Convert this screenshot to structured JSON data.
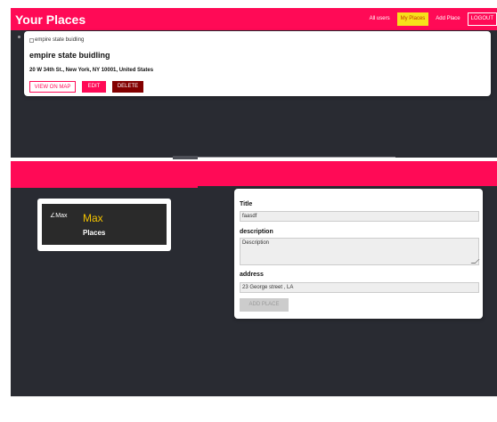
{
  "header": {
    "title": "Your Places",
    "nav": {
      "all_users": "All users",
      "my_places": "My Places",
      "add_place": "Add Place",
      "logout": "LOGOUT"
    }
  },
  "place": {
    "image_alt": "empire state buidling",
    "title": "empire state buidling",
    "address": "20 W 34th St., New York, NY 10001, United States",
    "buttons": {
      "view_on_map": "VIEW ON MAP",
      "edit": "EDIT",
      "delete": "DELETE"
    }
  },
  "brand": {
    "logo_text": "Max",
    "name": "Max",
    "subtitle": "Places"
  },
  "form": {
    "title_label": "Title",
    "title_value": "faasdf",
    "description_label": "description",
    "description_placeholder": "Description",
    "address_label": "address",
    "address_value": "23 George street , LA",
    "submit_label": "ADD PLACE"
  },
  "colors": {
    "accent": "#ff0a56",
    "active_nav": "#f7e11a",
    "danger": "#830000",
    "background_dark": "#292b32"
  }
}
